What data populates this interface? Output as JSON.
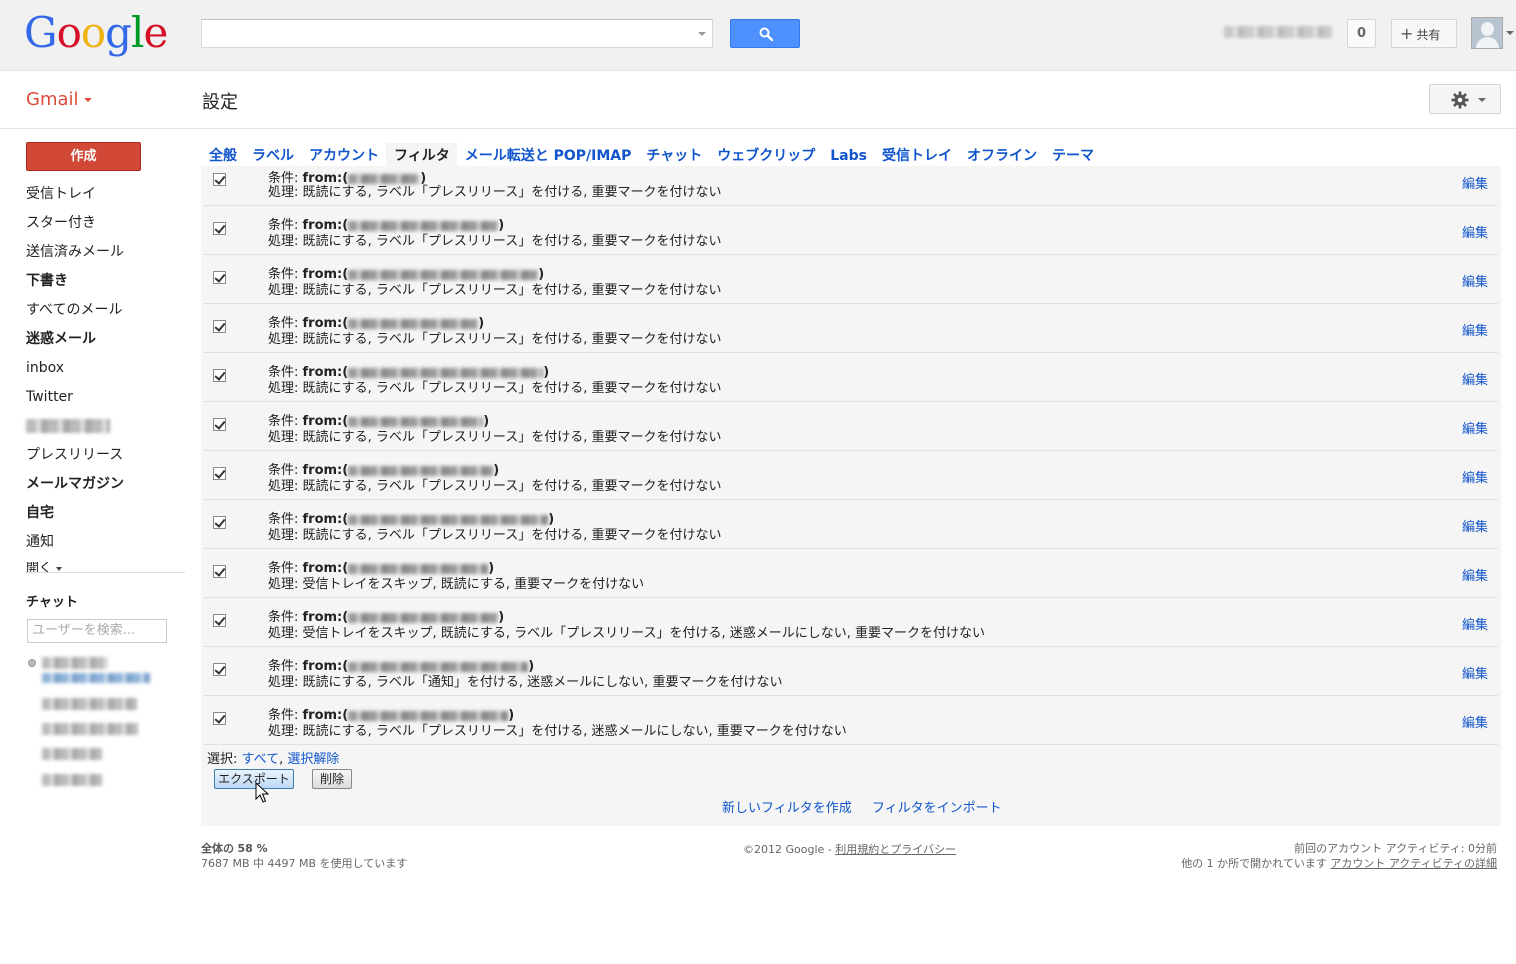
{
  "header": {
    "logo_text": "Google",
    "logo_colors": [
      "#3369e8",
      "#d50f25",
      "#eeb211",
      "#3369e8",
      "#009925",
      "#d50f25"
    ],
    "notification_count": "0",
    "share_label": "共有"
  },
  "subheader": {
    "app_label": "Gmail",
    "page_title": "設定"
  },
  "nav": {
    "compose_label": "作成",
    "items": [
      {
        "label": "受信トレイ",
        "bold": false
      },
      {
        "label": "スター付き",
        "bold": false
      },
      {
        "label": "送信済みメール",
        "bold": false
      },
      {
        "label": "下書き",
        "bold": true
      },
      {
        "label": "すべてのメール",
        "bold": false
      },
      {
        "label": "迷惑メール",
        "bold": true
      },
      {
        "label": "inbox",
        "bold": false
      },
      {
        "label": "Twitter",
        "bold": false
      },
      {
        "label": "",
        "bold": false,
        "redacted": true
      },
      {
        "label": "プレスリリース",
        "bold": false
      },
      {
        "label": "メールマガジン",
        "bold": true
      },
      {
        "label": "自宅",
        "bold": true
      },
      {
        "label": "通知",
        "bold": false
      }
    ],
    "more_label": "開く",
    "chat_heading": "チャット",
    "chat_search_placeholder": "ユーザーを検索..."
  },
  "tabs": [
    {
      "label": "全般",
      "active": false
    },
    {
      "label": "ラベル",
      "active": false
    },
    {
      "label": "アカウント",
      "active": false
    },
    {
      "label": "フィルタ",
      "active": true
    },
    {
      "label": "メール転送と POP/IMAP",
      "active": false
    },
    {
      "label": "チャット",
      "active": false
    },
    {
      "label": "ウェブクリップ",
      "active": false
    },
    {
      "label": "Labs",
      "active": false
    },
    {
      "label": "受信トレイ",
      "active": false
    },
    {
      "label": "オフライン",
      "active": false
    },
    {
      "label": "テーマ",
      "active": false
    }
  ],
  "filters": {
    "condition_prefix": "条件: ",
    "from_prefix": "from:(",
    "from_suffix": ")",
    "action_prefix": "処理: ",
    "edit_label": "編集",
    "rows": [
      {
        "checked": true,
        "action": "既読にする, ラベル「プレスリリース」を付ける, 重要マークを付けない"
      },
      {
        "checked": true,
        "action": "既読にする, ラベル「プレスリリース」を付ける, 重要マークを付けない"
      },
      {
        "checked": true,
        "action": "既読にする, ラベル「プレスリリース」を付ける, 重要マークを付けない"
      },
      {
        "checked": true,
        "action": "既読にする, ラベル「プレスリリース」を付ける, 重要マークを付けない"
      },
      {
        "checked": true,
        "action": "既読にする, ラベル「プレスリリース」を付ける, 重要マークを付けない"
      },
      {
        "checked": true,
        "action": "既読にする, ラベル「プレスリリース」を付ける, 重要マークを付けない"
      },
      {
        "checked": true,
        "action": "既読にする, ラベル「プレスリリース」を付ける, 重要マークを付けない"
      },
      {
        "checked": true,
        "action": "既読にする, ラベル「プレスリリース」を付ける, 重要マークを付けない"
      },
      {
        "checked": true,
        "action": "受信トレイをスキップ, 既読にする, 重要マークを付けない"
      },
      {
        "checked": true,
        "action": "受信トレイをスキップ, 既読にする, ラベル「プレスリリース」を付ける, 迷惑メールにしない, 重要マークを付けない"
      },
      {
        "checked": true,
        "action": "既読にする, ラベル「通知」を付ける, 迷惑メールにしない, 重要マークを付けない"
      },
      {
        "checked": true,
        "action": "既読にする, ラベル「プレスリリース」を付ける, 迷惑メールにしない, 重要マークを付けない"
      }
    ],
    "select_label": "選択: ",
    "select_all": "すべて",
    "select_none": "選択解除",
    "export_label": "エクスポート",
    "delete_label": "削除",
    "create_filter_link": "新しいフィルタを作成",
    "import_filter_link": "フィルタをインポート"
  },
  "footer": {
    "usage_label": "全体の",
    "usage_percent": "58 %",
    "usage_detail": "7687 MB 中 4497 MB を使用しています",
    "copyright": "©2012 Google - ",
    "terms_link": "利用規約とプライバシー",
    "last_activity": "前回のアカウント アクティビティ: 0分前",
    "other_location": "他の 1 か所で開かれています  ",
    "details_link": "アカウント アクティビティの詳細"
  }
}
